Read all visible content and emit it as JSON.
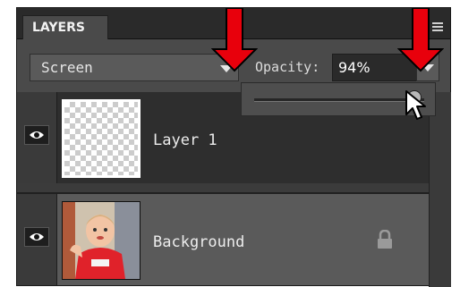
{
  "panel": {
    "tab_label": "LAYERS",
    "blend_mode": "Screen",
    "opacity_label": "Opacity:",
    "opacity_value": "94%",
    "opacity_slider_level": 0.94
  },
  "layers": [
    {
      "name": "Layer 1",
      "selected": true,
      "thumbnail": "transparent-checkerboard"
    },
    {
      "name": "Background",
      "selected": false,
      "thumbnail": "photo-child-in-red-shirt",
      "locked": true
    }
  ],
  "icons": {
    "visibility": "eye-icon",
    "lock": "lock-icon",
    "menu": "panel-menu-icon",
    "dropdown": "chevron-down-icon",
    "cursor": "mouse-pointer-icon",
    "annotation": "red-down-arrow"
  },
  "colors": {
    "panel_bg": "#3b3b3b",
    "selected_row": "#2e2e2e",
    "unselected_row": "#5a5a5a",
    "annotation_arrow": "#e8000c"
  }
}
